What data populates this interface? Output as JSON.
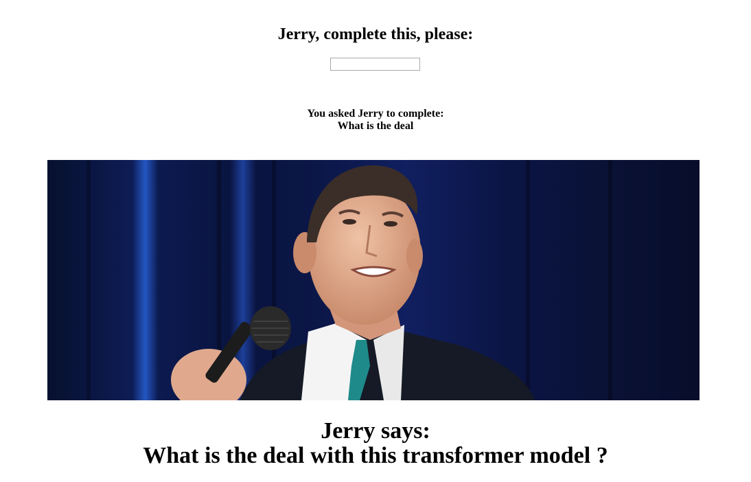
{
  "prompt": {
    "title": "Jerry, complete this, please:",
    "input_value": "",
    "input_placeholder": ""
  },
  "asked": {
    "label": "You asked Jerry to complete:",
    "text": "What is the deal"
  },
  "image": {
    "icon": "jerry-seinfeld-photo",
    "subject": "Jerry Seinfeld holding a microphone in front of a blue curtain"
  },
  "answer": {
    "label": "Jerry says:",
    "text": "What is the deal with this transformer model ?"
  },
  "colors": {
    "curtain_dark": "#0a1230",
    "curtain_highlight": "#1f4fb0",
    "suit": "#141824",
    "tie": "#1f8a8a",
    "shirt": "#f4f4f4",
    "skin": "#d9a183"
  }
}
